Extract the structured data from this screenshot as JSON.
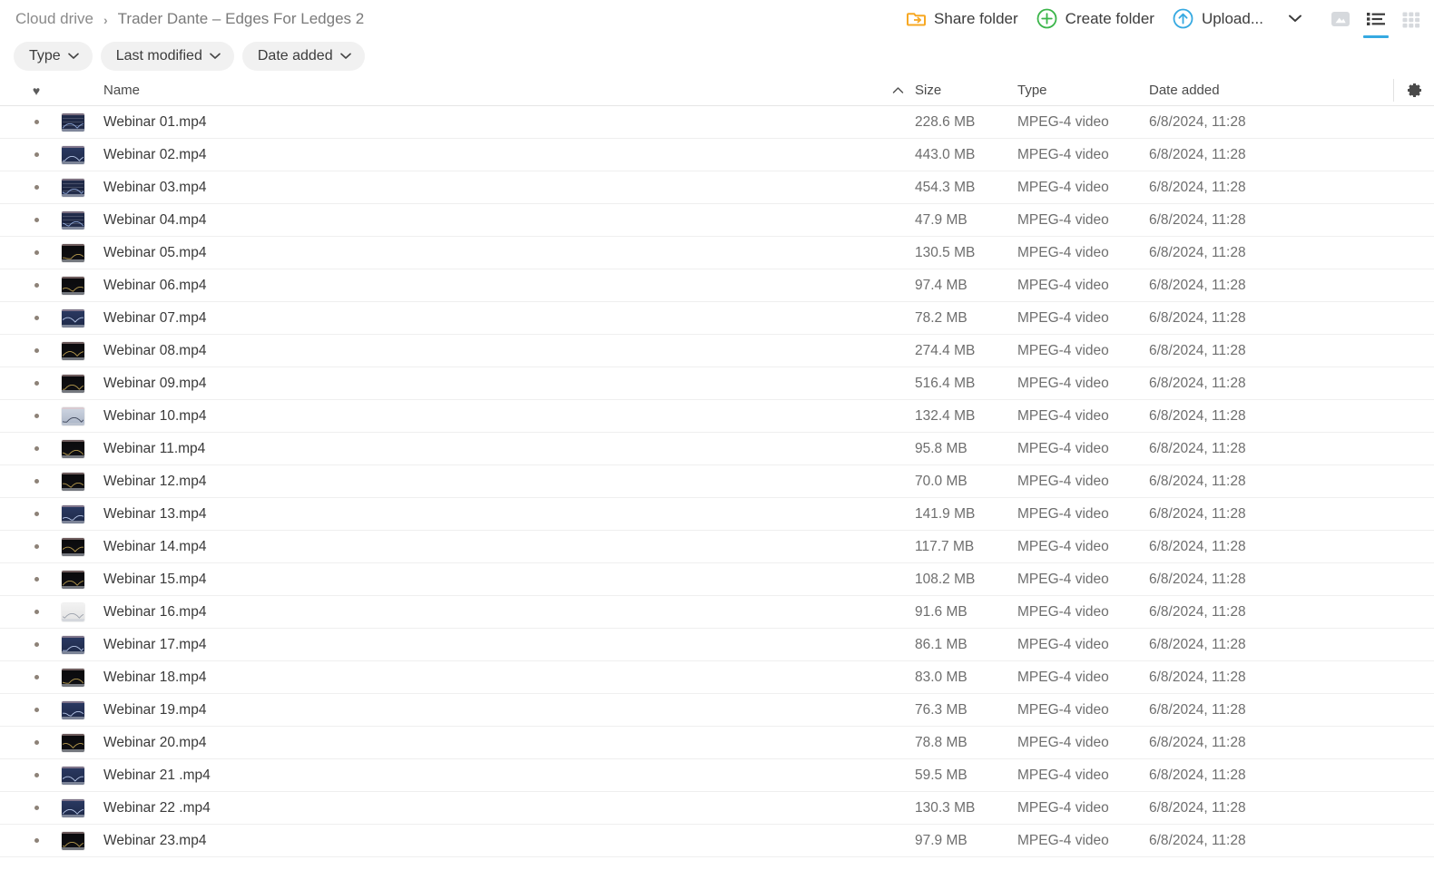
{
  "breadcrumb": {
    "root": "Cloud drive",
    "separator": "›",
    "current": "Trader Dante – Edges For Ledges 2"
  },
  "toolbar": {
    "share_folder_label": "Share folder",
    "create_folder_label": "Create folder",
    "upload_label": "Upload...",
    "upload_caret": "⌄",
    "views": [
      {
        "name": "gallery-view",
        "active": false
      },
      {
        "name": "list-view",
        "active": true
      },
      {
        "name": "grid-view",
        "active": false
      }
    ],
    "accent_blue": "#36a9e1",
    "share_orange": "#f7a823",
    "create_green": "#3bb54a"
  },
  "filters": [
    {
      "label": "Type",
      "caret": "⌄"
    },
    {
      "label": "Last modified",
      "caret": "⌄"
    },
    {
      "label": "Date added",
      "caret": "⌄"
    }
  ],
  "table": {
    "headers": {
      "favorite_icon": "♥",
      "name": "Name",
      "sort_indicator": "⌃",
      "size": "Size",
      "type": "Type",
      "date_added": "Date added",
      "settings_icon": "gear-icon"
    },
    "rows": [
      {
        "name": "Webinar 01.mp4",
        "size": "228.6 MB",
        "type": "MPEG-4 video",
        "date": "6/8/2024, 11:28",
        "thumb": "chart-blue-grid"
      },
      {
        "name": "Webinar 02.mp4",
        "size": "443.0 MB",
        "type": "MPEG-4 video",
        "date": "6/8/2024, 11:28",
        "thumb": "chart-blue"
      },
      {
        "name": "Webinar 03.mp4",
        "size": "454.3 MB",
        "type": "MPEG-4 video",
        "date": "6/8/2024, 11:28",
        "thumb": "chart-blue-grid"
      },
      {
        "name": "Webinar 04.mp4",
        "size": "47.9 MB",
        "type": "MPEG-4 video",
        "date": "6/8/2024, 11:28",
        "thumb": "chart-blue-grid"
      },
      {
        "name": "Webinar 05.mp4",
        "size": "130.5 MB",
        "type": "MPEG-4 video",
        "date": "6/8/2024, 11:28",
        "thumb": "chart-dark"
      },
      {
        "name": "Webinar 06.mp4",
        "size": "97.4 MB",
        "type": "MPEG-4 video",
        "date": "6/8/2024, 11:28",
        "thumb": "chart-dark"
      },
      {
        "name": "Webinar 07.mp4",
        "size": "78.2 MB",
        "type": "MPEG-4 video",
        "date": "6/8/2024, 11:28",
        "thumb": "chart-blue"
      },
      {
        "name": "Webinar 08.mp4",
        "size": "274.4 MB",
        "type": "MPEG-4 video",
        "date": "6/8/2024, 11:28",
        "thumb": "chart-dark"
      },
      {
        "name": "Webinar 09.mp4",
        "size": "516.4 MB",
        "type": "MPEG-4 video",
        "date": "6/8/2024, 11:28",
        "thumb": "chart-dark"
      },
      {
        "name": "Webinar 10.mp4",
        "size": "132.4 MB",
        "type": "MPEG-4 video",
        "date": "6/8/2024, 11:28",
        "thumb": "chart-light"
      },
      {
        "name": "Webinar 11.mp4",
        "size": "95.8 MB",
        "type": "MPEG-4 video",
        "date": "6/8/2024, 11:28",
        "thumb": "chart-dark"
      },
      {
        "name": "Webinar 12.mp4",
        "size": "70.0 MB",
        "type": "MPEG-4 video",
        "date": "6/8/2024, 11:28",
        "thumb": "chart-dark"
      },
      {
        "name": "Webinar 13.mp4",
        "size": "141.9 MB",
        "type": "MPEG-4 video",
        "date": "6/8/2024, 11:28",
        "thumb": "chart-blue"
      },
      {
        "name": "Webinar 14.mp4",
        "size": "117.7 MB",
        "type": "MPEG-4 video",
        "date": "6/8/2024, 11:28",
        "thumb": "chart-dark"
      },
      {
        "name": "Webinar 15.mp4",
        "size": "108.2 MB",
        "type": "MPEG-4 video",
        "date": "6/8/2024, 11:28",
        "thumb": "chart-dark"
      },
      {
        "name": "Webinar 16.mp4",
        "size": "91.6 MB",
        "type": "MPEG-4 video",
        "date": "6/8/2024, 11:28",
        "thumb": "chart-white"
      },
      {
        "name": "Webinar 17.mp4",
        "size": "86.1 MB",
        "type": "MPEG-4 video",
        "date": "6/8/2024, 11:28",
        "thumb": "chart-blue"
      },
      {
        "name": "Webinar 18.mp4",
        "size": "83.0 MB",
        "type": "MPEG-4 video",
        "date": "6/8/2024, 11:28",
        "thumb": "chart-dark"
      },
      {
        "name": "Webinar 19.mp4",
        "size": "76.3 MB",
        "type": "MPEG-4 video",
        "date": "6/8/2024, 11:28",
        "thumb": "chart-blue"
      },
      {
        "name": "Webinar 20.mp4",
        "size": "78.8 MB",
        "type": "MPEG-4 video",
        "date": "6/8/2024, 11:28",
        "thumb": "chart-dark"
      },
      {
        "name": "Webinar 21 .mp4",
        "size": "59.5 MB",
        "type": "MPEG-4 video",
        "date": "6/8/2024, 11:28",
        "thumb": "chart-blue"
      },
      {
        "name": "Webinar 22 .mp4",
        "size": "130.3 MB",
        "type": "MPEG-4 video",
        "date": "6/8/2024, 11:28",
        "thumb": "chart-blue"
      },
      {
        "name": "Webinar 23.mp4",
        "size": "97.9 MB",
        "type": "MPEG-4 video",
        "date": "6/8/2024, 11:28",
        "thumb": "chart-dark"
      }
    ]
  }
}
